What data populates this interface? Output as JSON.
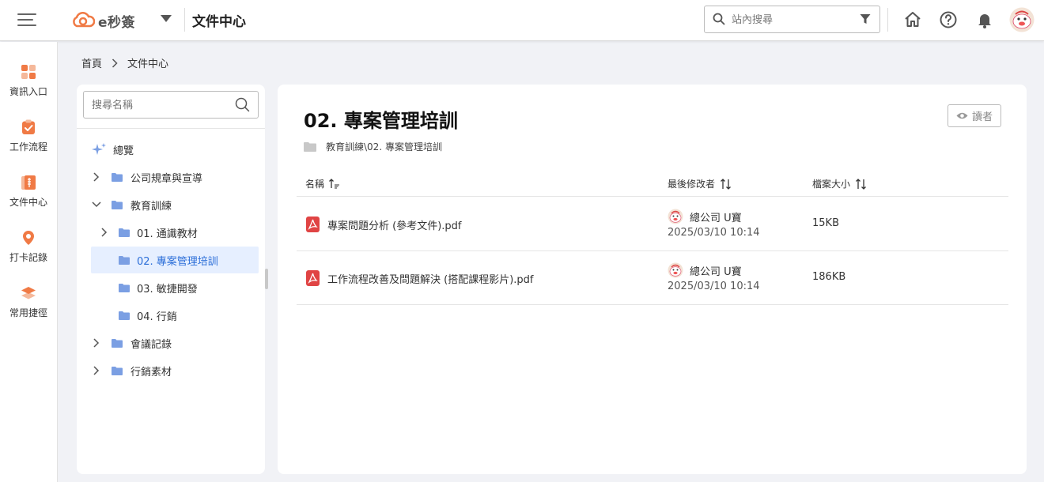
{
  "app": {
    "logo_text": "e秒簽",
    "title": "文件中心"
  },
  "search": {
    "placeholder": "站內搜尋"
  },
  "rail": {
    "items": [
      {
        "label": "資訊入口",
        "color": "#f07a45"
      },
      {
        "label": "工作流程",
        "color": "#f07a45"
      },
      {
        "label": "文件中心",
        "color": "#f07a45"
      },
      {
        "label": "打卡記錄",
        "color": "#f07a45"
      },
      {
        "label": "常用捷徑",
        "color": "#f07a45"
      }
    ]
  },
  "breadcrumb": {
    "home": "首頁",
    "current": "文件中心"
  },
  "tree": {
    "search_placeholder": "搜尋名稱",
    "overview": "總覽",
    "items": [
      {
        "label": "公司規章與宣導",
        "expanded": false
      },
      {
        "label": "教育訓練",
        "expanded": true
      },
      {
        "label": "01. 通識教材",
        "expanded": false
      },
      {
        "label": "02. 專案管理培訓",
        "selected": true
      },
      {
        "label": "03. 敏捷開發"
      },
      {
        "label": "04. 行銷"
      },
      {
        "label": "會議記錄",
        "expanded": false
      },
      {
        "label": "行銷素材",
        "expanded": false
      }
    ]
  },
  "main": {
    "title": "02. 專案管理培訓",
    "reader_label": "讀者",
    "path": "教育訓練\\02. 專案管理培訓",
    "columns": {
      "name": "名稱",
      "modifier": "最後修改者",
      "size": "檔案大小"
    },
    "files": [
      {
        "name": "專案問題分析 (參考文件).pdf",
        "modifier": "總公司 U寶",
        "modified": "2025/03/10 10:14",
        "size": "15KB"
      },
      {
        "name": "工作流程改善及問題解決 (搭配課程影片).pdf",
        "modifier": "總公司 U寶",
        "modified": "2025/03/10 10:14",
        "size": "186KB"
      }
    ]
  },
  "colors": {
    "accent": "#f07a45",
    "selected_bg": "#e6efff",
    "selected_text": "#2b6ed8",
    "folder": "#7b9fe3",
    "pdf": "#e04444"
  }
}
